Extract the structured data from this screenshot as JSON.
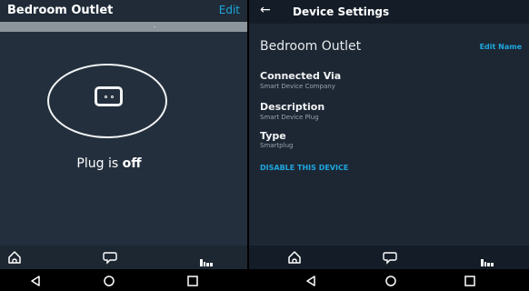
{
  "left": {
    "header": {
      "title": "Bedroom Outlet",
      "edit_label": "Edit"
    },
    "device_icon": "plug-icon",
    "status": {
      "prefix": "Plug is ",
      "state": "off"
    },
    "nav": {
      "items": [
        "home-icon",
        "chat-icon",
        "devices-icon"
      ]
    }
  },
  "right": {
    "header": {
      "back_icon": "back-arrow-icon",
      "back_glyph": "←",
      "title": "Device Settings"
    },
    "device_name": "Bedroom Outlet",
    "edit_name_label": "Edit Name",
    "fields": [
      {
        "label": "Connected Via",
        "value": "Smart Device Company"
      },
      {
        "label": "Description",
        "value": "Smart Device Plug"
      },
      {
        "label": "Type",
        "value": "Smartplug"
      }
    ],
    "disable_label": "DISABLE THIS DEVICE",
    "nav": {
      "items": [
        "home-icon",
        "chat-icon",
        "devices-icon"
      ]
    }
  },
  "system_nav": {
    "items": [
      "back-triangle-icon",
      "home-circle-icon",
      "recents-square-icon"
    ]
  },
  "colors": {
    "accent": "#1ea7df",
    "panel_bg": "#232f3d",
    "nav_bg": "#141d27"
  }
}
